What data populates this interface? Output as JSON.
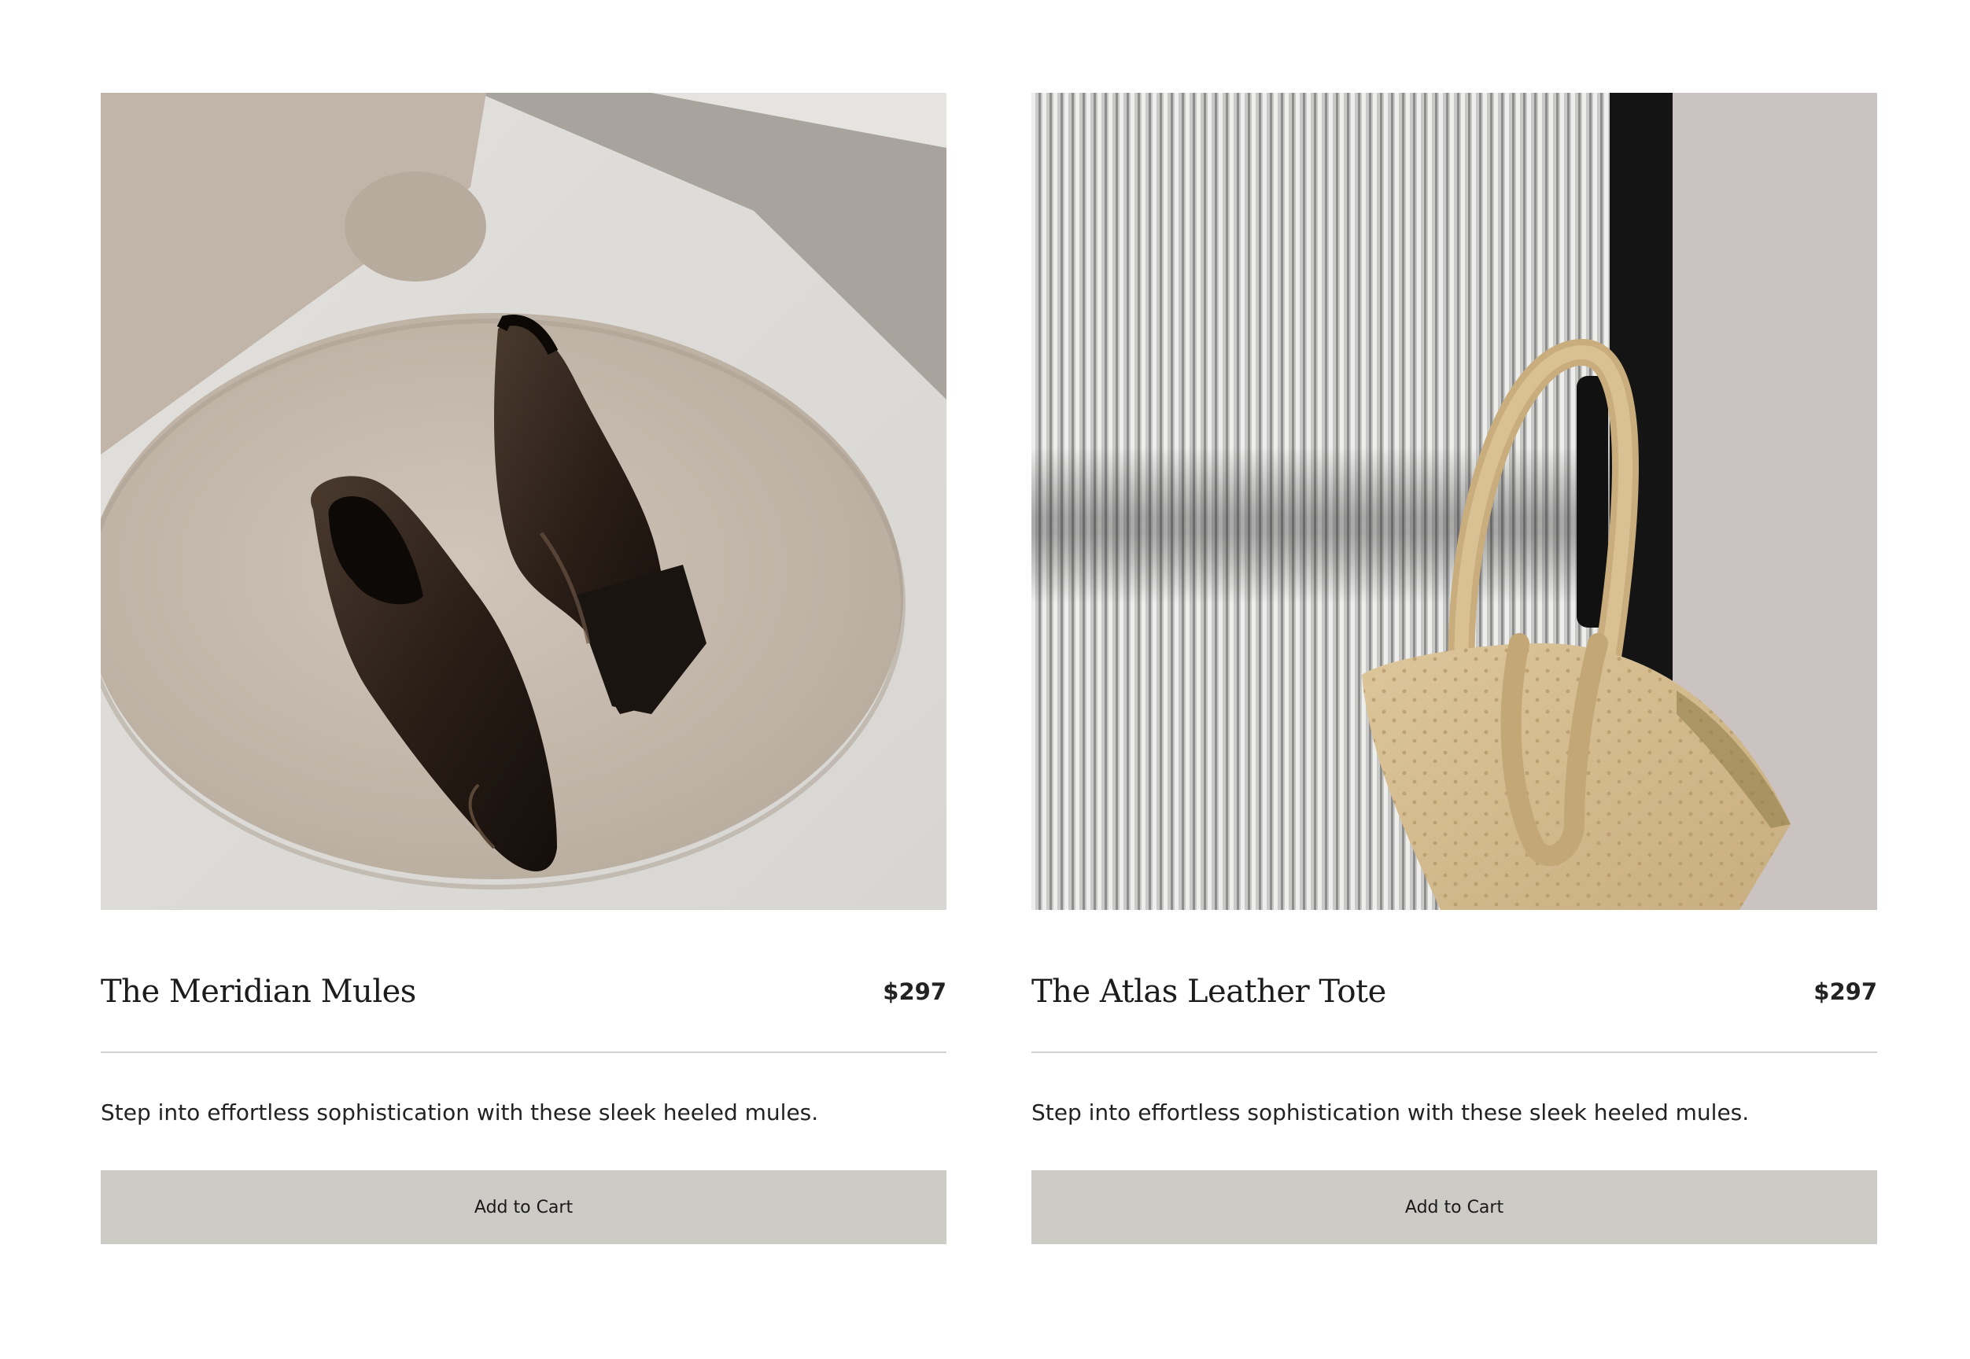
{
  "products": [
    {
      "image_alt": "Dark brown leather heeled mules on a round beige velvet stool",
      "title": "The Meridian Mules",
      "price": "$297",
      "description": "Step into effortless sophistication with these sleek heeled mules.",
      "cta": "Add to Cart"
    },
    {
      "image_alt": "Sand ostrich-textured leather tote hanging beside a ribbed glass door",
      "title": "The Atlas Leather Tote",
      "price": "$297",
      "description": "Step into effortless sophistication with these sleek heeled mules.",
      "cta": "Add to Cart"
    }
  ],
  "colors": {
    "button_bg": "#cdcbc6",
    "divider": "#d2d2d2",
    "text": "#1a1a1a"
  }
}
